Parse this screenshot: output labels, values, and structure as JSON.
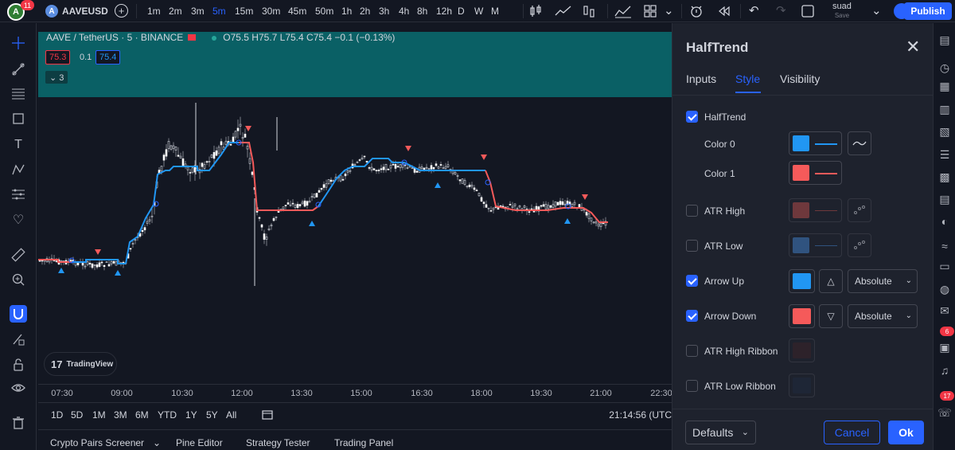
{
  "topbar": {
    "avatar_letter": "A",
    "avatar_badge": "11",
    "symbol_icon": "A",
    "symbol": "AAVEUSD",
    "timeframes": [
      "1m",
      "2m",
      "3m",
      "5m",
      "15m",
      "30m",
      "45m",
      "50m",
      "1h",
      "2h",
      "3h",
      "4h",
      "8h",
      "12h",
      "D",
      "W",
      "M"
    ],
    "active_timeframe": "5m",
    "user_name": "suad",
    "user_save": "Save",
    "publish_label": "Publish"
  },
  "chart": {
    "legend_title": "AAVE / TetherUS · 5 · BINANCE",
    "ohlc": "O75.5 H75.7 L75.4 C75.4 −0.1 (−0.13%)",
    "bid": "75.3",
    "spread": "0.1",
    "ask": "75.4",
    "collapse_label": "⌄ 3",
    "watermark": "TradingView",
    "xaxis_labels": [
      "07:30",
      "09:00",
      "10:30",
      "12:00",
      "13:30",
      "15:00",
      "16:30",
      "18:00",
      "19:30",
      "21:00",
      "22:30"
    ]
  },
  "rangebar": {
    "ranges": [
      "1D",
      "5D",
      "1M",
      "3M",
      "6M",
      "YTD",
      "1Y",
      "5Y",
      "All"
    ],
    "clock": "21:14:56 (UTC"
  },
  "bottombar": {
    "tabs": [
      "Crypto Pairs Screener",
      "Pine Editor",
      "Strategy Tester",
      "Trading Panel"
    ]
  },
  "dialog": {
    "title": "HalfTrend",
    "tabs": [
      "Inputs",
      "Style",
      "Visibility"
    ],
    "active_tab": "Style",
    "rows": {
      "halftrend": "HalfTrend",
      "color0": "Color 0",
      "color1": "Color 1",
      "atr_high": "ATR High",
      "atr_low": "ATR Low",
      "arrow_up": "Arrow Up",
      "arrow_down": "Arrow Down",
      "atr_high_ribbon": "ATR High Ribbon",
      "atr_low_ribbon": "ATR Low Ribbon"
    },
    "arrow_up_mode": "Absolute",
    "arrow_down_mode": "Absolute",
    "defaults_label": "Defaults",
    "cancel_label": "Cancel",
    "ok_label": "Ok"
  },
  "colors": {
    "up": "#2196f3",
    "down": "#f55a5a",
    "accent": "#2962ff",
    "header_bg": "#0a6065"
  },
  "rightstrip": {
    "badge1": "6",
    "badge2": "17"
  }
}
